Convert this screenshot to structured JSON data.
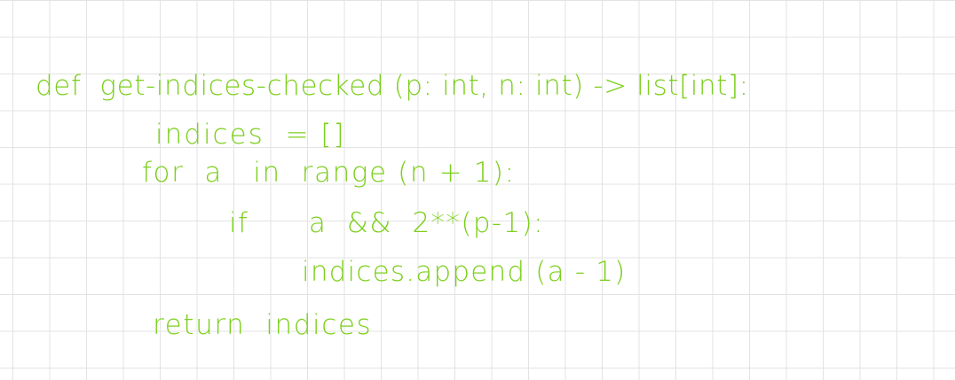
{
  "note": {
    "ink_color": "#7ccf1c",
    "grid_color": "#e3e3e3",
    "lines": [
      "def  get-indices-checked (p: int, n: int) -> list[int]:",
      "indices  = []",
      "for  a   in  range (n + 1):",
      "if      a  &&  2**(p-1):",
      "indices.append (a - 1)",
      "return  indices"
    ]
  }
}
